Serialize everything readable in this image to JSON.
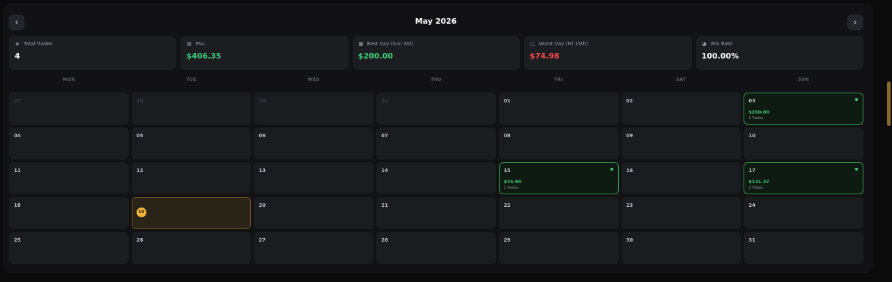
{
  "header": {
    "title": "May 2026",
    "prev_icon": "chevron-left-icon",
    "next_icon": "chevron-right-icon"
  },
  "stats": [
    {
      "icon": "stack-icon",
      "glyph": "◈",
      "label": "Total Trades",
      "value": "4",
      "tone": "white"
    },
    {
      "icon": "wallet-icon",
      "glyph": "▤",
      "label": "P&L",
      "value": "$406.35",
      "tone": "green"
    },
    {
      "icon": "calendar-icon",
      "glyph": "▦",
      "label": "Best Day (Sun 3rd)",
      "value": "$200.00",
      "tone": "green"
    },
    {
      "icon": "calendar-icon",
      "glyph": "▢",
      "label": "Worst Day (Fri 15th)",
      "value": "$74.98",
      "tone": "red"
    },
    {
      "icon": "pie-icon",
      "glyph": "◕",
      "label": "Win Rate",
      "value": "100.00%",
      "tone": "white"
    }
  ],
  "weekdays": [
    "MON",
    "TUE",
    "WED",
    "THU",
    "FRI",
    "SAT",
    "SUN"
  ],
  "days": [
    {
      "num": "27",
      "muted": true
    },
    {
      "num": "28",
      "muted": true
    },
    {
      "num": "29",
      "muted": true
    },
    {
      "num": "30",
      "muted": true
    },
    {
      "num": "01"
    },
    {
      "num": "02"
    },
    {
      "num": "03",
      "trade": true,
      "pnl": "$200.00",
      "count": "1 Trades"
    },
    {
      "num": "04"
    },
    {
      "num": "05"
    },
    {
      "num": "06"
    },
    {
      "num": "07"
    },
    {
      "num": "08"
    },
    {
      "num": "09"
    },
    {
      "num": "10"
    },
    {
      "num": "11"
    },
    {
      "num": "12"
    },
    {
      "num": "13"
    },
    {
      "num": "14"
    },
    {
      "num": "15",
      "trade": true,
      "pnl": "$74.98",
      "count": "1 Trades"
    },
    {
      "num": "16"
    },
    {
      "num": "17",
      "trade": true,
      "pnl": "$131.37",
      "count": "2 Trades"
    },
    {
      "num": "18"
    },
    {
      "num": "19",
      "today": true
    },
    {
      "num": "20"
    },
    {
      "num": "21"
    },
    {
      "num": "22"
    },
    {
      "num": "23"
    },
    {
      "num": "24"
    },
    {
      "num": "25"
    },
    {
      "num": "26"
    },
    {
      "num": "27"
    },
    {
      "num": "28"
    },
    {
      "num": "29"
    },
    {
      "num": "30"
    },
    {
      "num": "31"
    }
  ],
  "colors": {
    "accent_green": "#3ad07a",
    "accent_red": "#ff4b4b",
    "today_gold": "#f3b63b"
  }
}
